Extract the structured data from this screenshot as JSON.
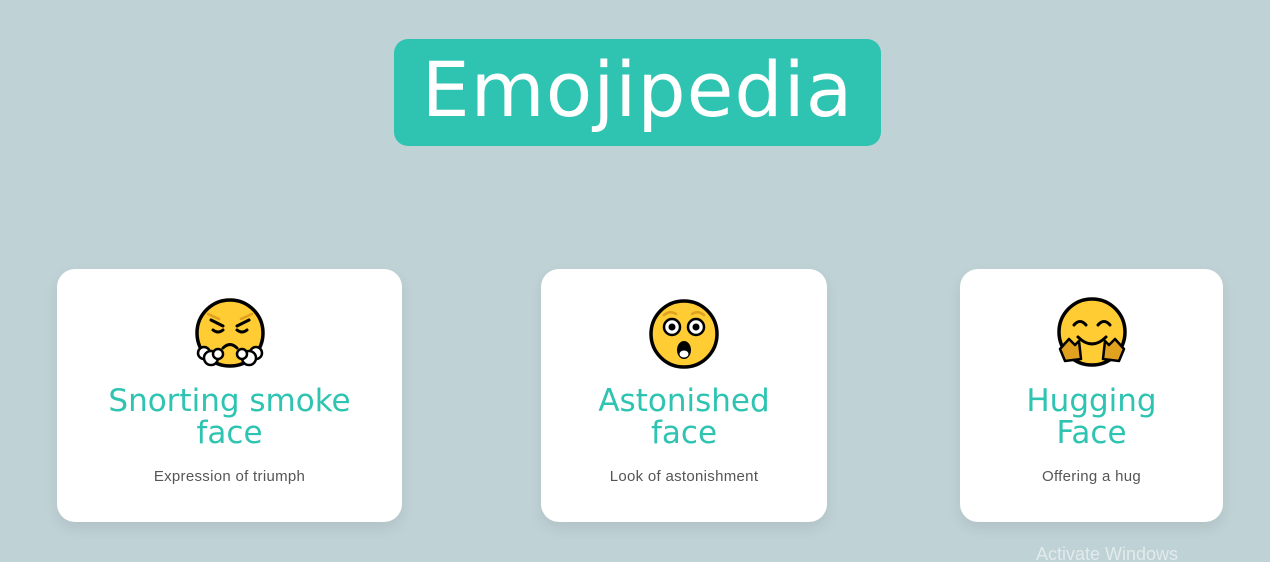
{
  "header": {
    "title": "Emojipedia"
  },
  "colors": {
    "background": "#BFD2D5",
    "accent": "#2EC4B1",
    "card": "#FFFFFF",
    "description_text": "#555555",
    "emoji_yellow": "#FFCC33"
  },
  "cards": [
    {
      "emoji_icon": "snorting-smoke-face-icon",
      "name": "Snorting smoke face",
      "description": "Expression of triumph"
    },
    {
      "emoji_icon": "astonished-face-icon",
      "name": "Astonished face",
      "description": "Look of astonishment"
    },
    {
      "emoji_icon": "hugging-face-icon",
      "name": "Hugging Face",
      "description": "Offering a hug"
    }
  ],
  "watermark": {
    "text": "Activate Windows"
  }
}
